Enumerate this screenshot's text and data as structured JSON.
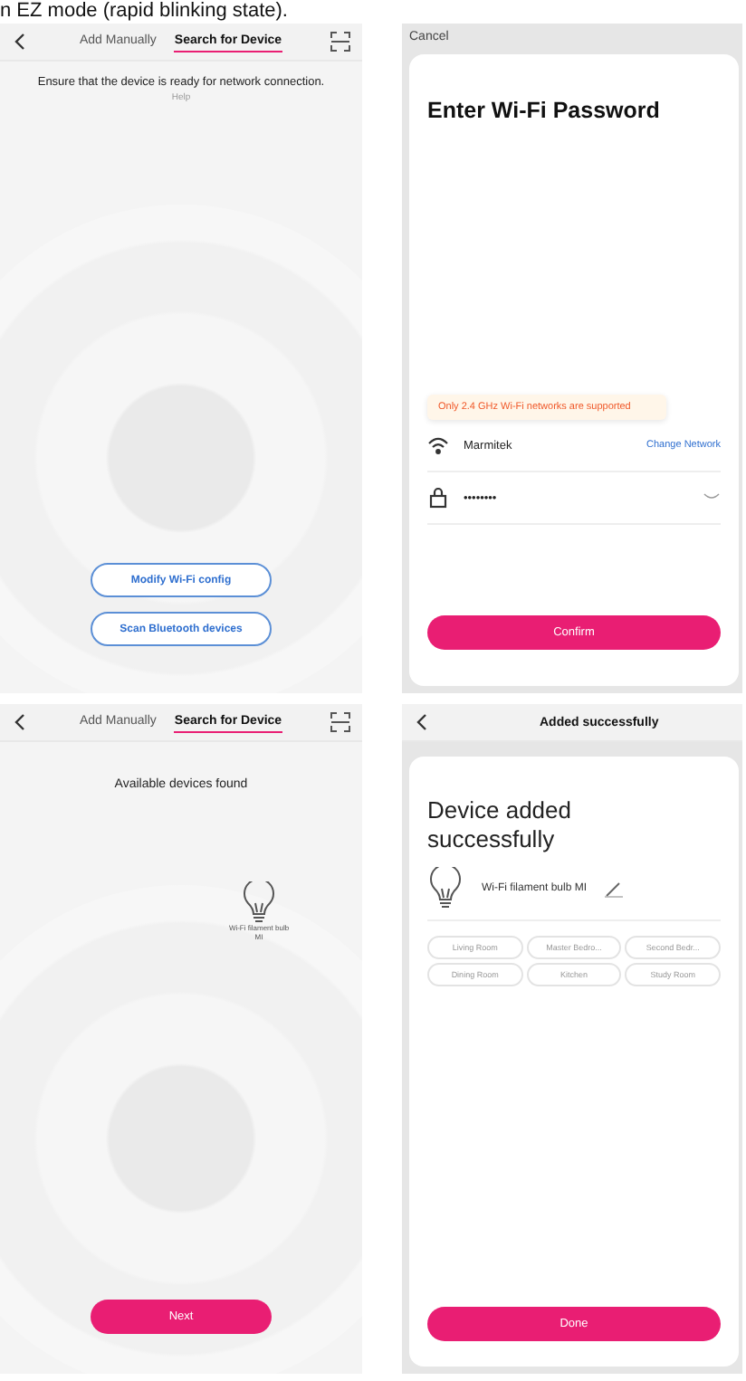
{
  "caption": "n EZ mode (rapid blinking state).",
  "screens": [
    {
      "kind": "search",
      "tabs": [
        {
          "label": "Add Manually",
          "selected": false
        },
        {
          "label": "Search for Device",
          "selected": true
        }
      ],
      "message": "Ensure that the device is ready for network connection.",
      "help": "Help",
      "buttons": [
        "Modify Wi-Fi config",
        "Scan Bluetooth devices"
      ]
    },
    {
      "kind": "wifi",
      "cancel": "Cancel",
      "title": "Enter Wi-Fi Password",
      "notice": "Only 2.4 GHz Wi-Fi networks are supported",
      "network": "Marmitek",
      "change": "Change Network",
      "password": "••••••••",
      "confirm": "Confirm"
    },
    {
      "kind": "found",
      "tabs": [
        {
          "label": "Add Manually",
          "selected": false
        },
        {
          "label": "Search for Device",
          "selected": true
        }
      ],
      "message": "Available devices found",
      "device": "Wi-Fi filament bulb MI",
      "next": "Next"
    },
    {
      "kind": "added",
      "header": "Added successfully",
      "title": "Device added successfully",
      "device": "Wi-Fi filament bulb MI",
      "rooms": [
        "Living Room",
        "Master Bedro...",
        "Second Bedr...",
        "Dining Room",
        "Kitchen",
        "Study Room"
      ],
      "done": "Done"
    }
  ]
}
